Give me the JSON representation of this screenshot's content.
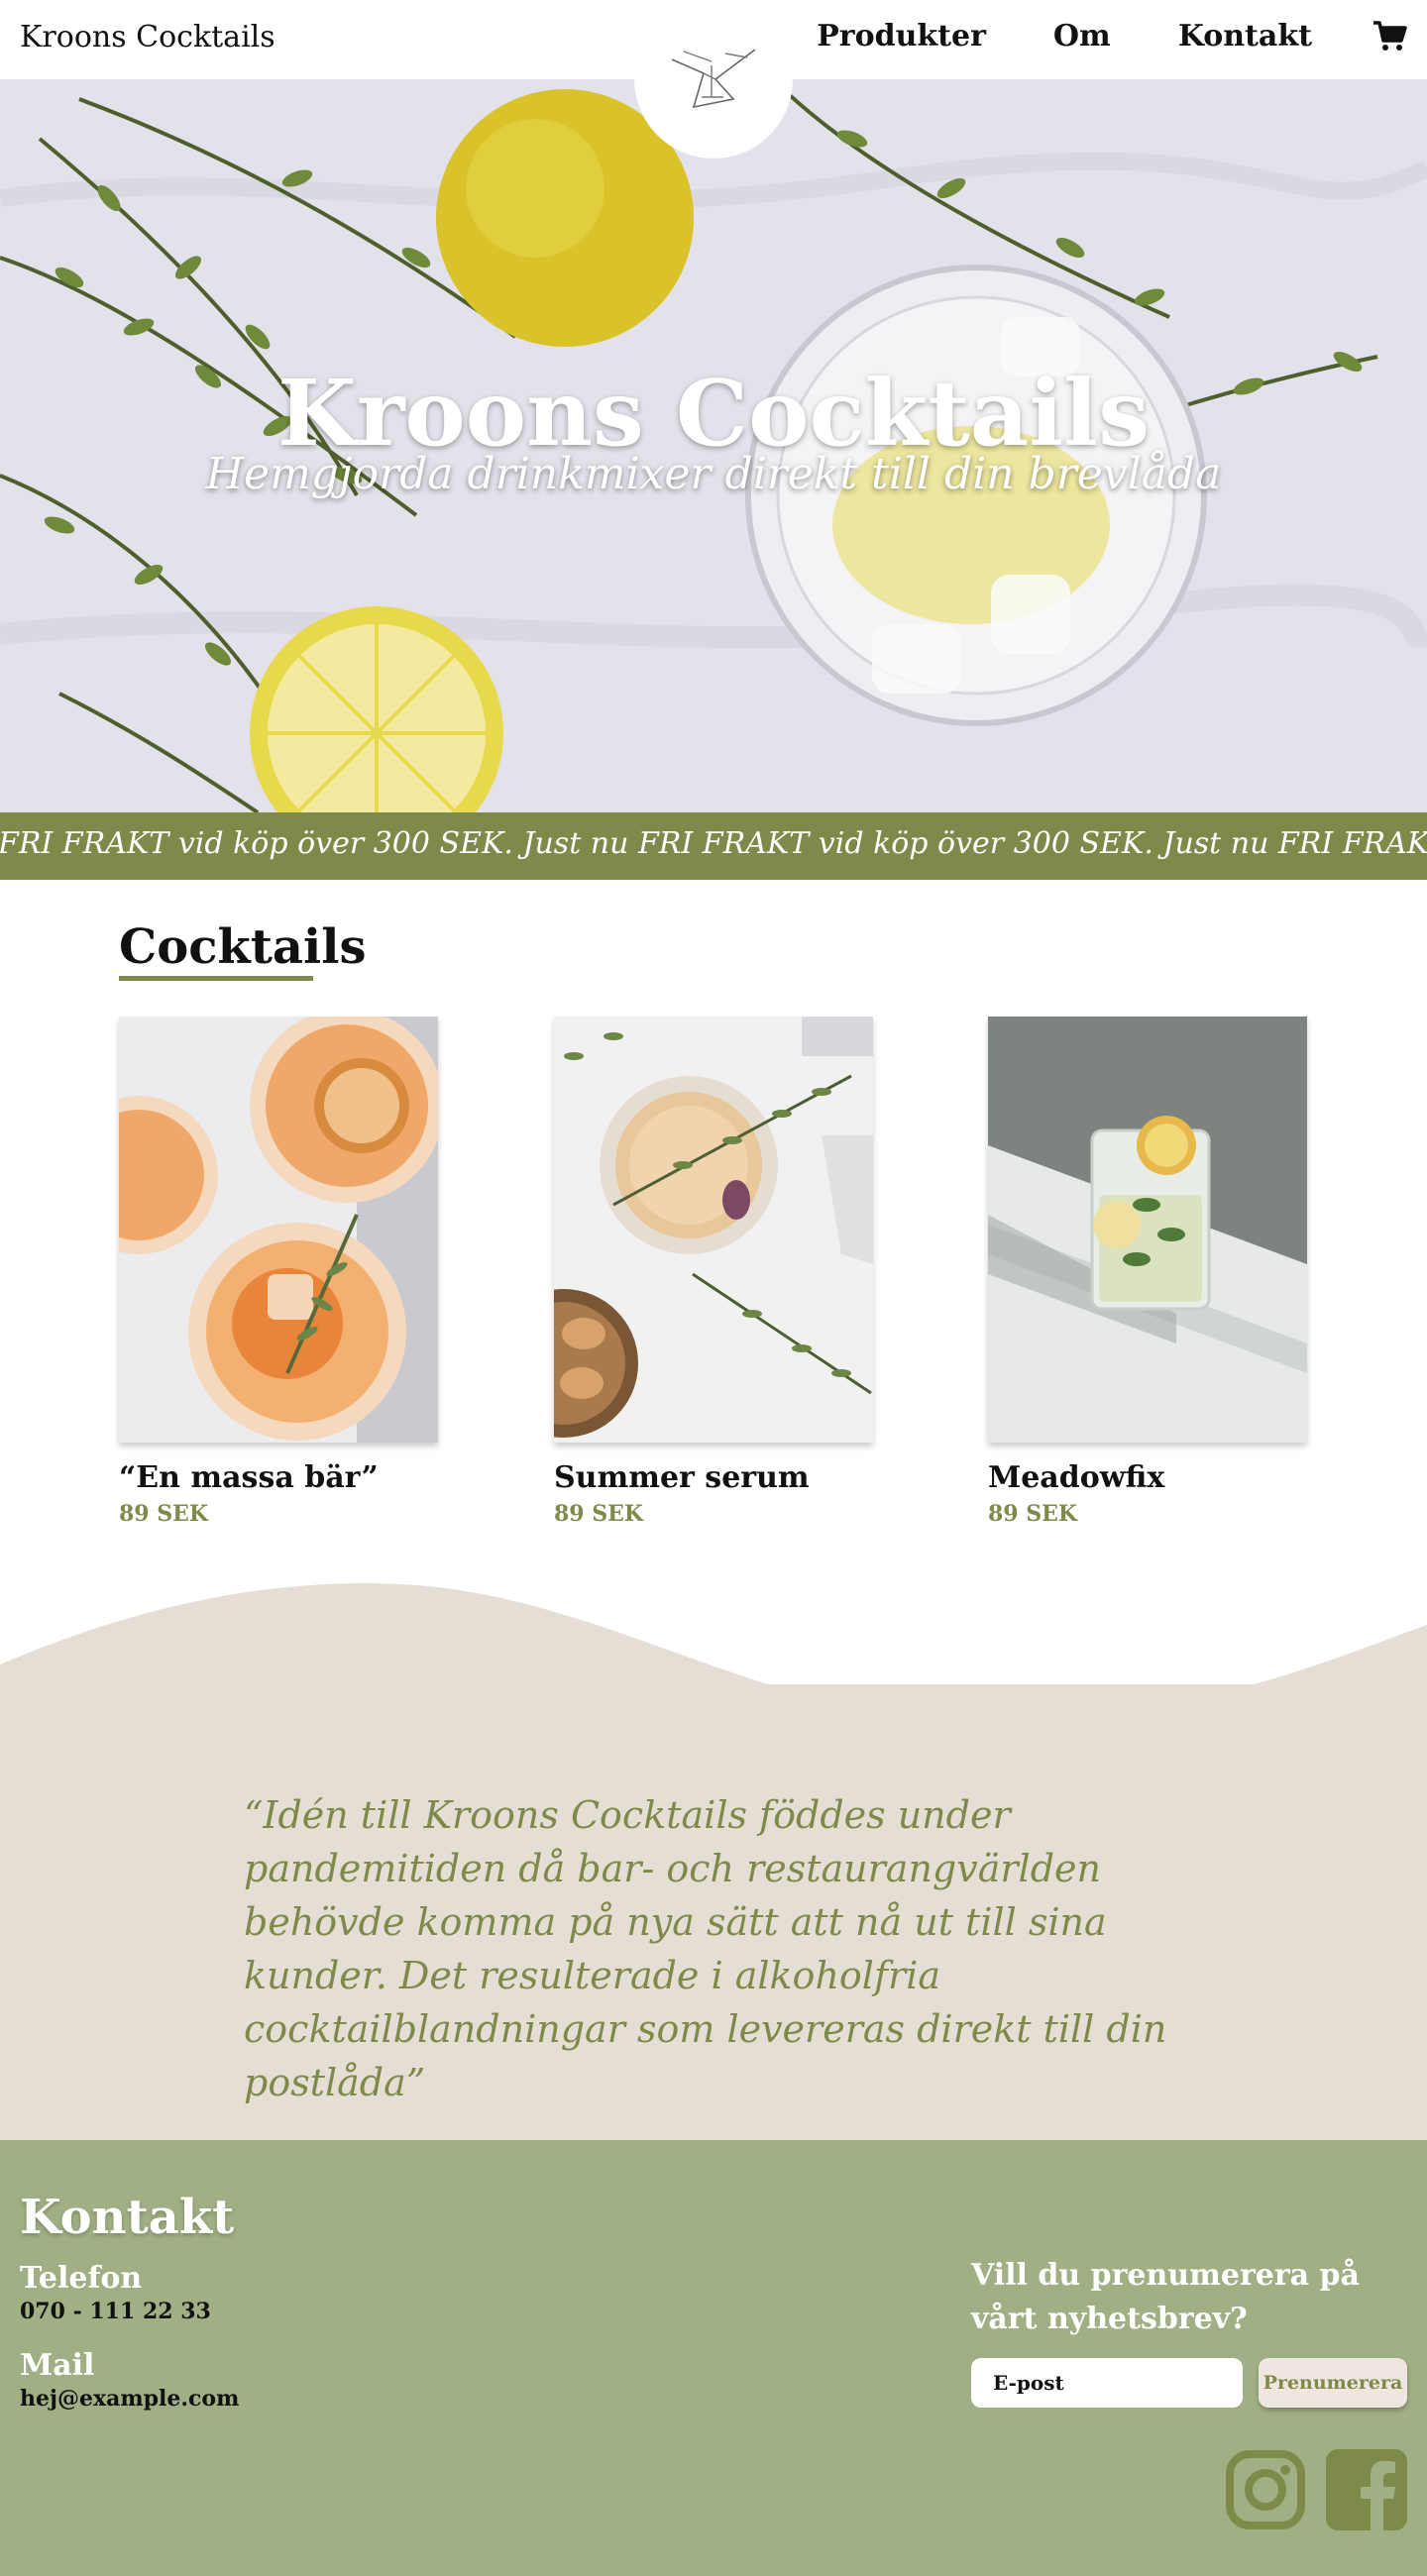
{
  "header": {
    "brand": "Kroons Cocktails",
    "nav": [
      "Produkter",
      "Om",
      "Kontakt"
    ],
    "cart_icon": "shopping-cart-icon",
    "logo_icon": "cocktail-logo-icon"
  },
  "hero": {
    "title": "Kroons Cocktails",
    "subtitle": "Hemgjorda drinkmixer direkt till din brevlåda"
  },
  "marquee": {
    "text": "FRI FRAKT vid köp över 300 SEK. Just nu FRI FRAKT vid köp över 300 SEK. Just nu FRI FRAKT vid köp över"
  },
  "cocktails": {
    "title": "Cocktails",
    "items": [
      {
        "name": "“En massa bär”",
        "price": "89 SEK"
      },
      {
        "name": "Summer serum",
        "price": "89 SEK"
      },
      {
        "name": "Meadowfix",
        "price": "89 SEK"
      }
    ]
  },
  "quote": {
    "text": "“Idén till Kroons Cocktails föddes under pandemitiden då bar- och restaurangvärlden behövde komma på nya sätt att nå ut till sina kunder. Det resulterade i alkoholfria cocktailblandningar som levereras direkt till din postlåda”"
  },
  "footer": {
    "title": "Kontakt",
    "phone_label": "Telefon",
    "phone": "070 - 111 22 33",
    "mail_label": "Mail",
    "mail": "hej@example.com",
    "newsletter_prompt": "Vill du prenumerera på vårt nyhetsbrev?",
    "email_placeholder": "E-post",
    "subscribe_label": "Prenumerera",
    "social_icons": [
      "instagram-icon",
      "facebook-icon"
    ]
  },
  "colors": {
    "accent_green": "#7e8a4a",
    "footer_green": "#a1b084",
    "quote_bg": "#e4ded5"
  }
}
